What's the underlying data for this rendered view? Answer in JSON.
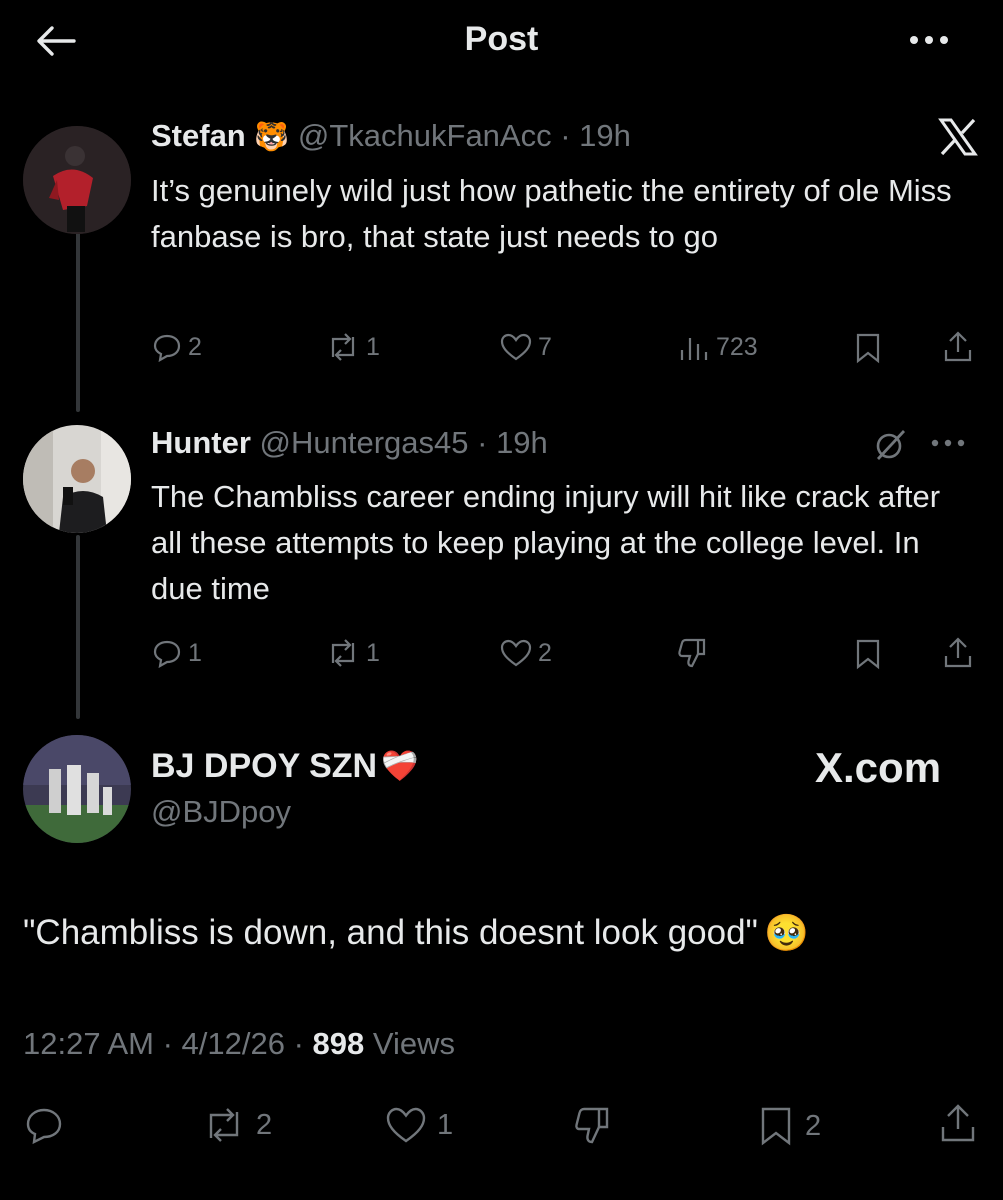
{
  "header": {
    "title": "Post"
  },
  "thread": [
    {
      "name": "Stefan",
      "name_emoji": "🐯",
      "handle": "@TkachukFanAcc",
      "time": "19h",
      "body": "It’s genuinely wild just how pathetic the entirety of ole Miss fanbase is bro, that state just needs to go",
      "actions": {
        "replies": "2",
        "reposts": "1",
        "likes": "7",
        "views": "723"
      }
    },
    {
      "name": "Hunter",
      "handle": "@Huntergas45",
      "time": "19h",
      "body": "The Chambliss career ending injury will hit like crack after all these attempts to keep playing at the college level. In due time",
      "actions": {
        "replies": "1",
        "reposts": "1",
        "likes": "2"
      }
    }
  ],
  "main": {
    "name": "BJ DPOY SZN",
    "name_emoji": "❤️‍🩹",
    "handle": "@BJDpoy",
    "brand": "X.com",
    "text": "\"Chambliss is down, and this doesnt look good\"",
    "text_emoji": "🥹",
    "time": "12:27 AM",
    "date": "4/12/26",
    "views_count": "898",
    "views_label": "Views",
    "actions": {
      "reposts": "2",
      "likes": "1",
      "bookmarks": "2"
    }
  },
  "colors": {
    "background": "#000000",
    "text": "#e7e9ea",
    "muted": "#71767b",
    "thread_line": "#333639"
  },
  "icons": [
    "back-arrow-icon",
    "more-icon",
    "x-logo-icon",
    "grok-icon",
    "reply-icon",
    "repost-icon",
    "like-icon",
    "views-icon",
    "dislike-icon",
    "bookmark-icon",
    "share-icon"
  ]
}
